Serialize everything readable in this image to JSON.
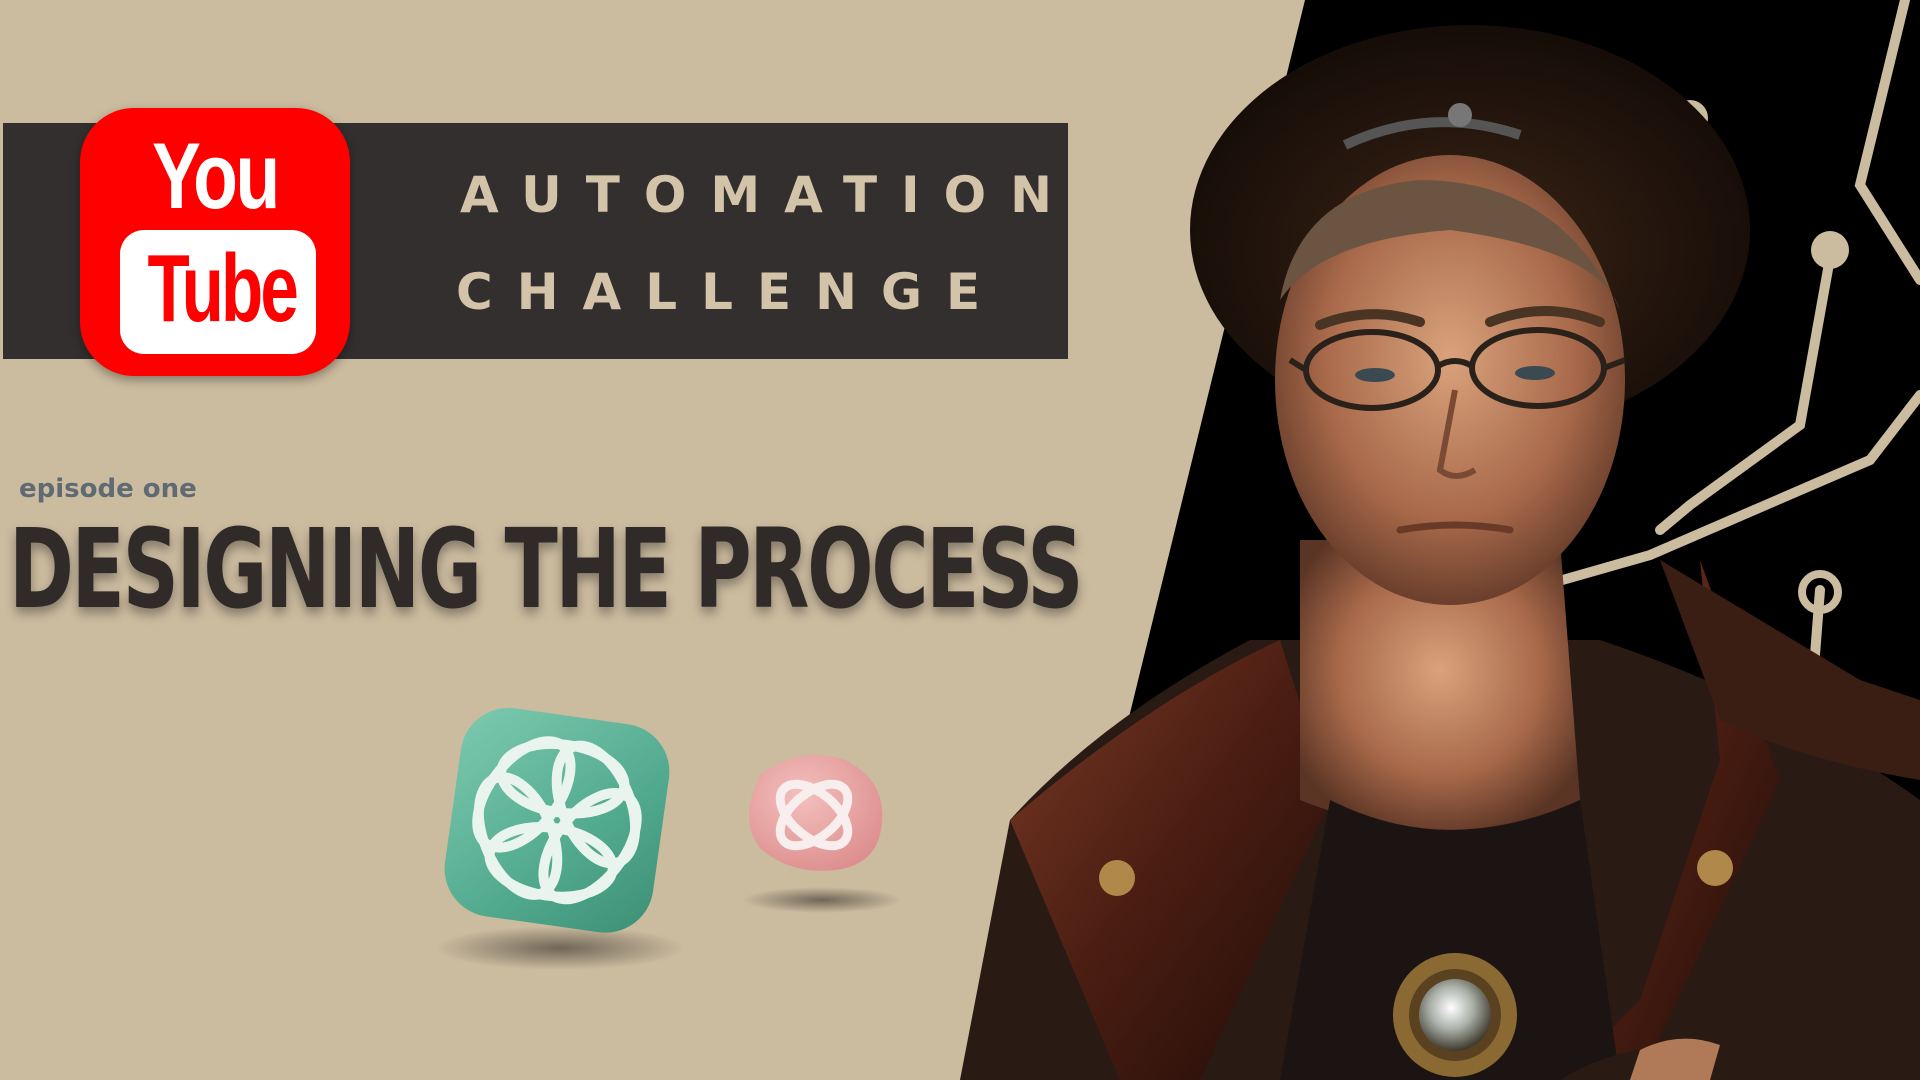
{
  "youtube_logo": {
    "line1": "You",
    "line2": "Tube"
  },
  "title": {
    "line1": "AUTOMATION",
    "line2": "CHALLENGE"
  },
  "episode": "episode one",
  "headline": "DESIGNING THE PROCESS",
  "colors": {
    "background": "#cbbb9f",
    "title_bar": "#342f2f",
    "title_text": "#d3c3a8",
    "youtube_red": "#fe0000",
    "headline": "#302b29",
    "episode_label": "#5f6a72",
    "dark_panel": "#000000",
    "circuit_lines": "#cbbb9f",
    "teal_icon": "#5fb59a",
    "pink_icon": "#e8a4a4"
  },
  "icons": {
    "large": "openai-knot-icon",
    "small": "atom-orbit-icon"
  }
}
